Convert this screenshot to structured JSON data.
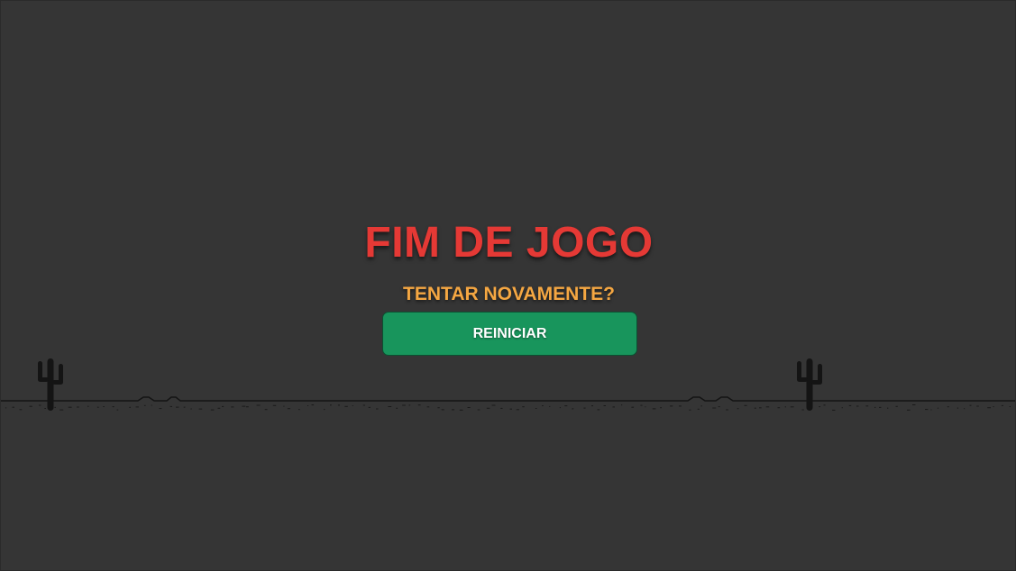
{
  "game_over": {
    "title": "FIM DE JOGO",
    "subtitle": "TENTAR NOVAMENTE?",
    "restart_label": "REINICIAR"
  },
  "colors": {
    "background": "#353535",
    "title": "#e53935",
    "subtitle": "#f5a742",
    "button": "#18955c",
    "ground": "#141414"
  },
  "scene": {
    "obstacles": [
      "cactus-icon",
      "cactus-icon"
    ]
  }
}
